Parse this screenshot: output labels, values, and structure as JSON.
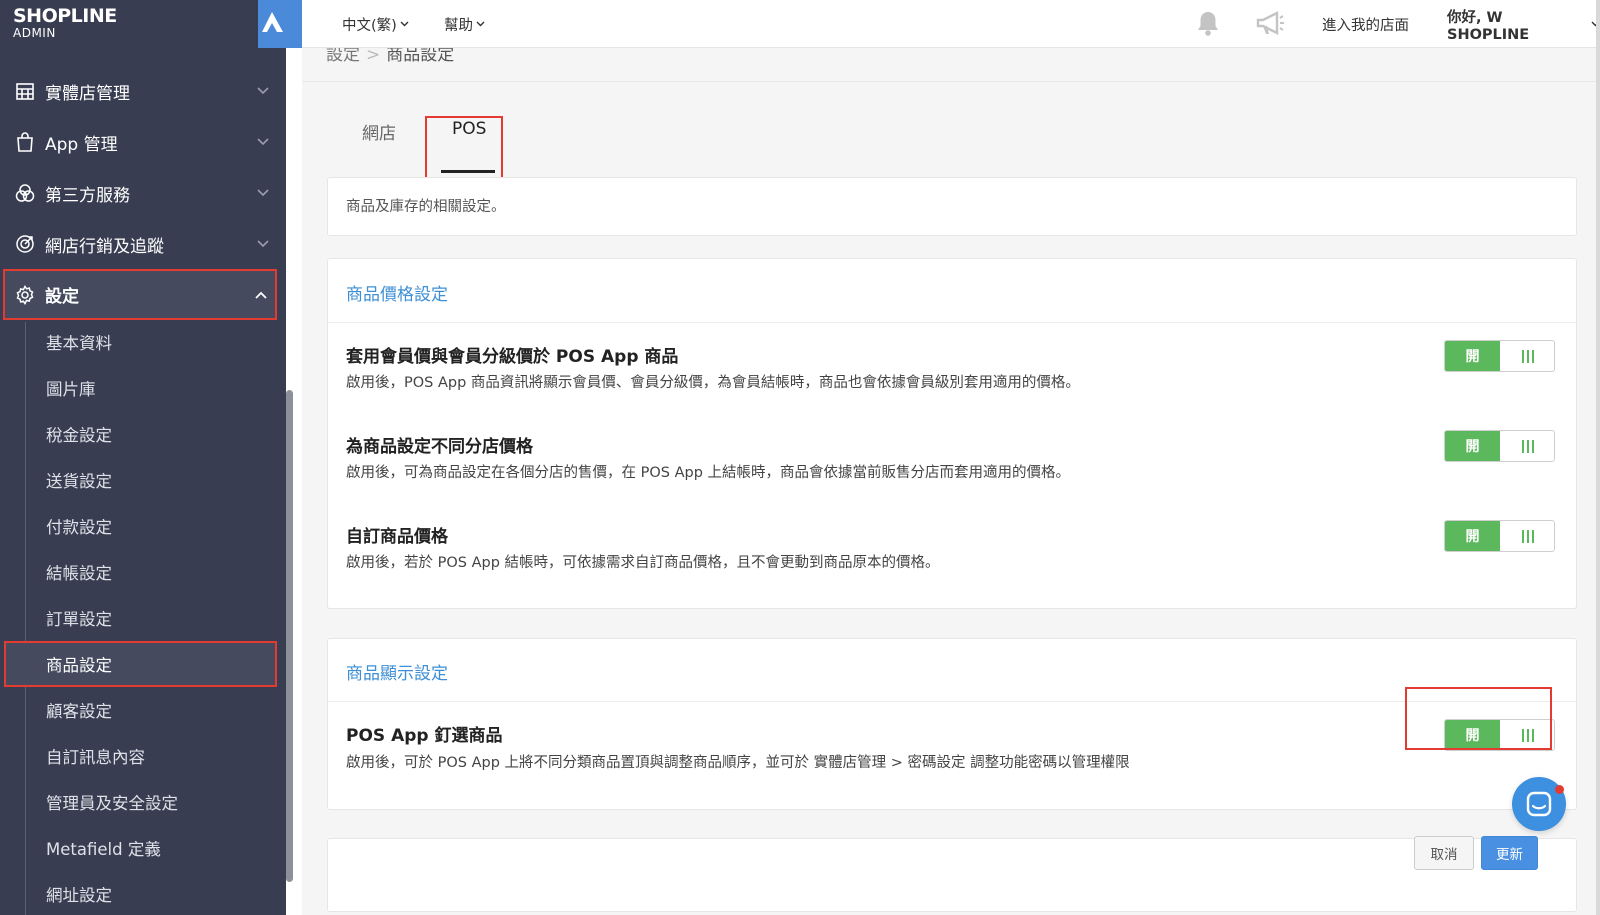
{
  "brand": {
    "name": "SHOPLINE",
    "sub": "ADMIN"
  },
  "topbar": {
    "language": "中文(繁)",
    "help": "幫助",
    "visit_store": "進入我的店面",
    "greeting": "你好, W SHOPLINE"
  },
  "sidebar": {
    "top_items": [
      {
        "label": "實體店管理",
        "icon": "store-icon"
      },
      {
        "label": "App 管理",
        "icon": "shopping-bag-icon"
      },
      {
        "label": "第三方服務",
        "icon": "circles-icon"
      },
      {
        "label": "網店行銷及追蹤",
        "icon": "target-icon"
      },
      {
        "label": "設定",
        "icon": "gear-icon"
      }
    ],
    "sub_items": [
      "基本資料",
      "圖片庫",
      "稅金設定",
      "送貨設定",
      "付款設定",
      "結帳設定",
      "訂單設定",
      "商品設定",
      "顧客設定",
      "自訂訊息內容",
      "管理員及安全設定",
      "Metafield 定義",
      "網址設定"
    ],
    "active_sub": "商品設定"
  },
  "breadcrumb": {
    "parent": "設定",
    "current": "商品設定"
  },
  "tabs": [
    "網店",
    "POS"
  ],
  "active_tab": "POS",
  "intro": "商品及庫存的相關設定。",
  "price_card": {
    "header": "商品價格設定",
    "rows": [
      {
        "title": "套用會員價與會員分級價於 POS App 商品",
        "desc": "啟用後，POS App 商品資訊將顯示會員價、會員分級價，為會員結帳時，商品也會依據會員級別套用適用的價格。",
        "toggle": "開"
      },
      {
        "title": "為商品設定不同分店價格",
        "desc": "啟用後，可為商品設定在各個分店的售價，在 POS App 上結帳時，商品會依據當前販售分店而套用適用的價格。",
        "toggle": "開"
      },
      {
        "title": "自訂商品價格",
        "desc": "啟用後，若於 POS App 結帳時，可依據需求自訂商品價格，且不會更動到商品原本的價格。",
        "toggle": "開"
      }
    ]
  },
  "display_card": {
    "header": "商品顯示設定",
    "rows": [
      {
        "title": "POS App 釘選商品",
        "desc": "啟用後，可於 POS App 上將不同分類商品置頂與調整商品順序，並可於 實體店管理 > 密碼設定 調整功能密碼以管理權限",
        "toggle": "開"
      }
    ]
  },
  "buttons": {
    "cancel": "取消",
    "update": "更新"
  },
  "colors": {
    "sidebar": "#383d51",
    "accent": "#3d8fd6",
    "toggle_on": "#5cb85c",
    "highlight": "#e23c32"
  }
}
